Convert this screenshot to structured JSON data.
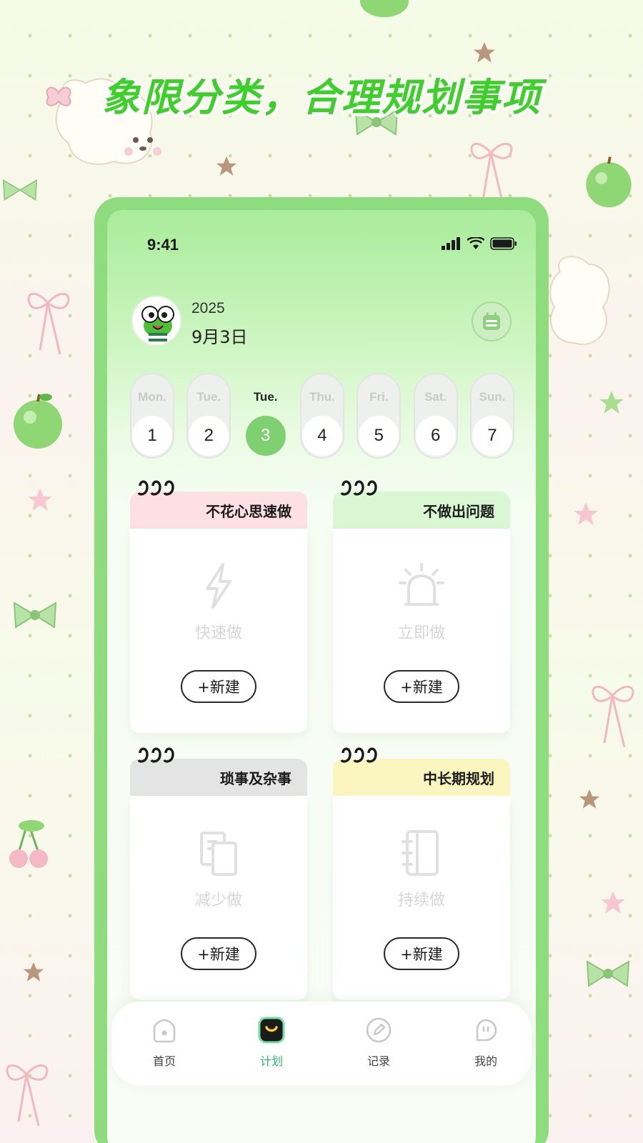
{
  "headline": "象限分类，合理规划事项",
  "status_bar": {
    "time": "9:41"
  },
  "header": {
    "year": "2025",
    "date": "9月3日"
  },
  "week": [
    {
      "name": "Mon.",
      "num": "1",
      "active": false
    },
    {
      "name": "Tue.",
      "num": "2",
      "active": false
    },
    {
      "name": "Tue.",
      "num": "3",
      "active": true
    },
    {
      "name": "Thu.",
      "num": "4",
      "active": false
    },
    {
      "name": "Fri.",
      "num": "5",
      "active": false
    },
    {
      "name": "Sat.",
      "num": "6",
      "active": false
    },
    {
      "name": "Sun.",
      "num": "7",
      "active": false
    }
  ],
  "quadrants": [
    {
      "title": "不花心思速做",
      "label": "快速做",
      "button": "+新建",
      "color": "#fde0e4",
      "icon": "lightning-icon"
    },
    {
      "title": "不做出问题",
      "label": "立即做",
      "button": "+新建",
      "color": "#d9f7d3",
      "icon": "alarm-light-icon"
    },
    {
      "title": "琐事及杂事",
      "label": "减少做",
      "button": "+新建",
      "color": "#e4e4e4",
      "icon": "document-icon"
    },
    {
      "title": "中长期规划",
      "label": "持续做",
      "button": "+新建",
      "color": "#fbf6c0",
      "icon": "notebook-icon"
    }
  ],
  "tabbar": {
    "items": [
      {
        "label": "首页",
        "icon": "home-icon",
        "active": false
      },
      {
        "label": "计划",
        "icon": "plan-icon",
        "active": true
      },
      {
        "label": "记录",
        "icon": "pen-icon",
        "active": false
      },
      {
        "label": "我的",
        "icon": "chat-icon",
        "active": false
      }
    ]
  },
  "colors": {
    "accent": "#7ed071",
    "headline": "#3ecf2a",
    "phone_frame": "#8fdc7e",
    "active_tab": "#2bb673"
  }
}
